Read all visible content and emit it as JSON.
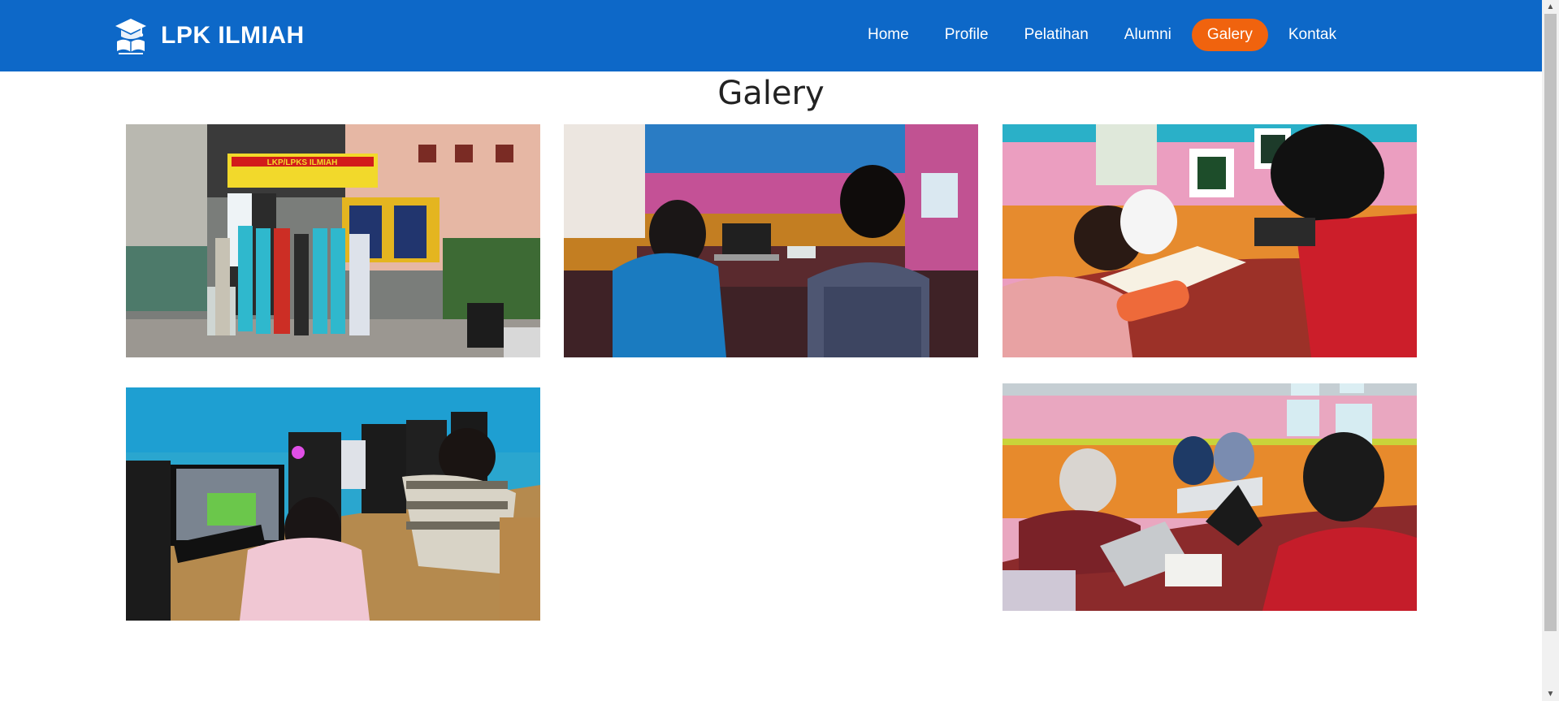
{
  "brand": {
    "name": "LPK ILMIAH",
    "logo_icon": "graduation-book-icon"
  },
  "nav": {
    "items": [
      {
        "label": "Home",
        "active": false
      },
      {
        "label": "Profile",
        "active": false
      },
      {
        "label": "Pelatihan",
        "active": false
      },
      {
        "label": "Alumni",
        "active": false
      },
      {
        "label": "Galery",
        "active": true
      },
      {
        "label": "Kontak",
        "active": false
      }
    ]
  },
  "gallery": {
    "title": "Galery",
    "photos": [
      {
        "sign_text": "LKP/LPKS ILMIAH"
      },
      {},
      {},
      {},
      {}
    ]
  },
  "colors": {
    "header": "#0d68c8",
    "active_nav": "#f0630e",
    "text_white": "#ffffff"
  }
}
